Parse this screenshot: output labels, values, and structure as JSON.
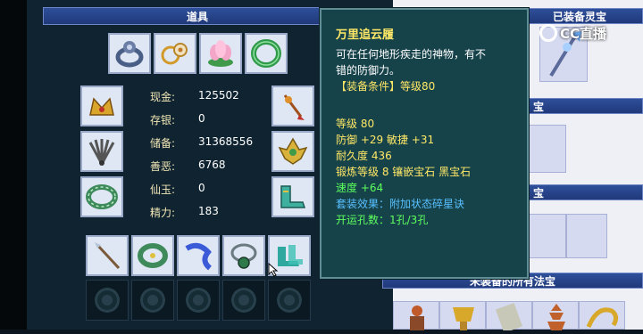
{
  "inventory": {
    "title": "道具",
    "currency": [
      {
        "label": "现金:",
        "value": "125502"
      },
      {
        "label": "存银:",
        "value": "0"
      },
      {
        "label": "储备:",
        "value": "31368556"
      },
      {
        "label": "善恶:",
        "value": "6768"
      },
      {
        "label": "仙玉:",
        "value": "0"
      },
      {
        "label": "精力:",
        "value": "183"
      }
    ]
  },
  "right_panel": {
    "equipped_spirit_title": "已装备灵宝",
    "section2_title": "宝",
    "section3_title": "宝",
    "unequipped_title": "未装备的所有法宝"
  },
  "tooltip": {
    "name": "万里追云履",
    "desc_line1": "可在任何地形疾走的神物，有不",
    "desc_line2": "错的防御力。",
    "requirement": "【装备条件】等级80",
    "level": "等级 80",
    "defense": "防御 +29 敏捷 +31",
    "durability": "耐久度 436",
    "forge": "锻炼等级 8 镶嵌宝石 黑宝石",
    "speed": "速度 +64",
    "set_effect": "套装效果：附加状态碎星诀",
    "holes": "开运孔数：1孔/3孔"
  },
  "watermark": {
    "text": "CC直播"
  },
  "colors": {
    "tooltip_bg": "#16424a",
    "title_bar": "#2e4f9a",
    "yellow_text": "#ffe866",
    "green_text": "#5dff5d",
    "blue_text": "#58c0ff"
  }
}
